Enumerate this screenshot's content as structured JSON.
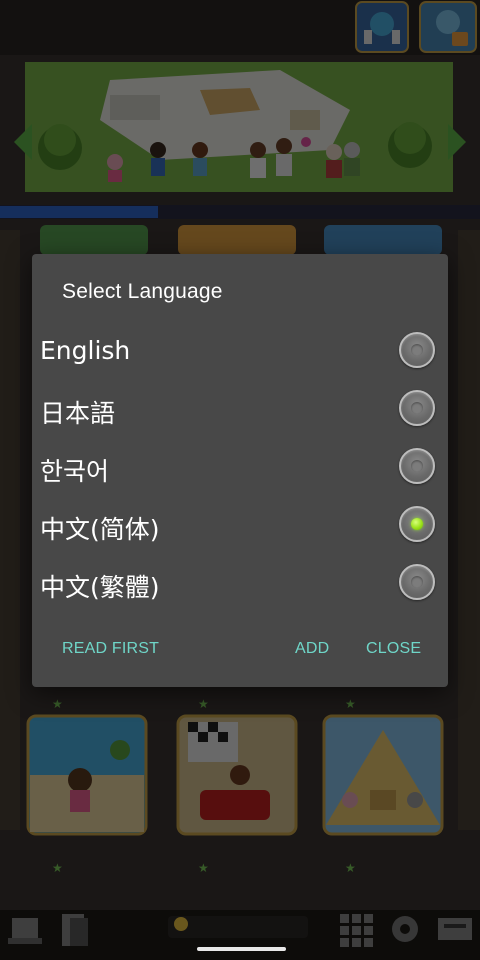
{
  "dialog": {
    "title": "Select Language",
    "languages": [
      {
        "label": "English",
        "selected": false
      },
      {
        "label": "日本語",
        "selected": false
      },
      {
        "label": "한국어",
        "selected": false
      },
      {
        "label": "中文(简体)",
        "selected": true
      },
      {
        "label": "中文(繁體)",
        "selected": false
      }
    ],
    "buttons": {
      "read_first": "READ FIRST",
      "add": "ADD",
      "close": "CLOSE"
    }
  },
  "colors": {
    "dialog_bg": "#484848",
    "button_text": "#6fd6c8",
    "radio_selected": "#9be21a"
  }
}
